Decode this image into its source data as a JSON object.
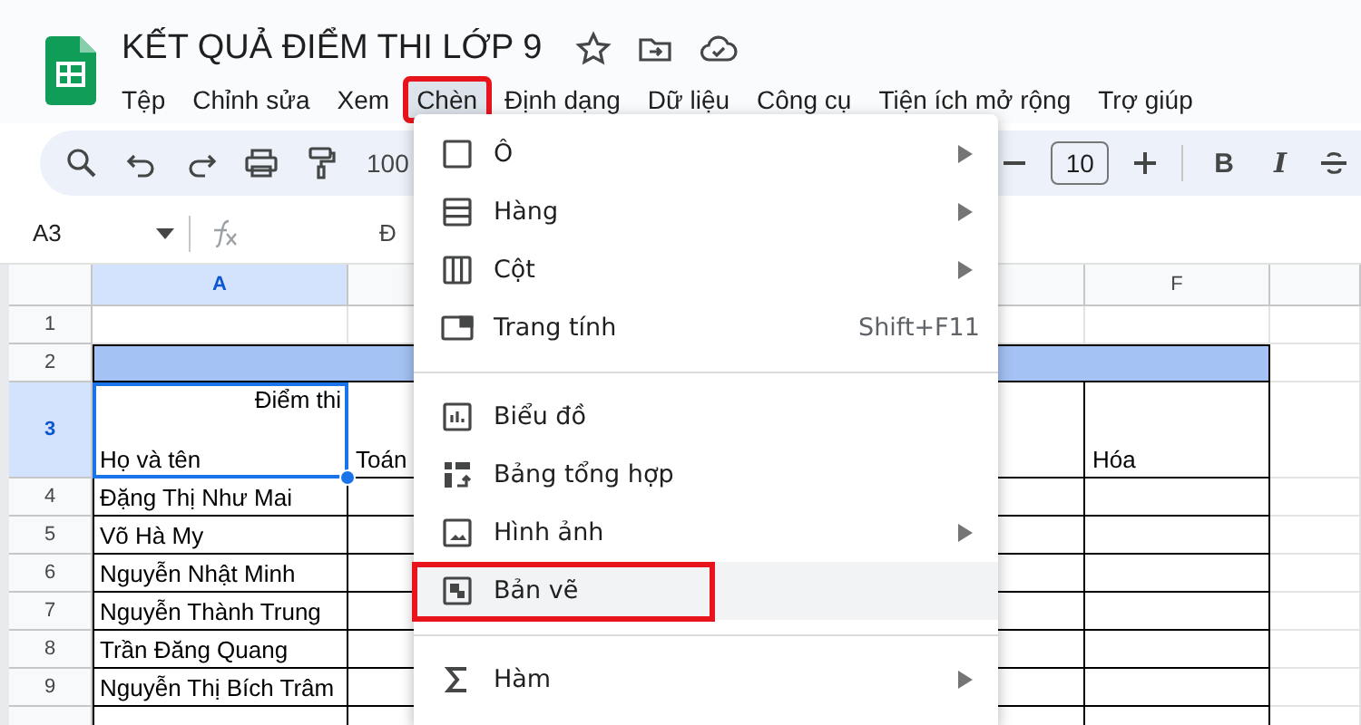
{
  "document": {
    "title": "KẾT QUẢ ĐIỂM THI LỚP 9"
  },
  "menu_bar": [
    {
      "label": "Tệp",
      "highlighted": false
    },
    {
      "label": "Chỉnh sửa",
      "highlighted": false
    },
    {
      "label": "Xem",
      "highlighted": false
    },
    {
      "label": "Chèn",
      "highlighted": true
    },
    {
      "label": "Định dạng",
      "highlighted": false
    },
    {
      "label": "Dữ liệu",
      "highlighted": false
    },
    {
      "label": "Công cụ",
      "highlighted": false
    },
    {
      "label": "Tiện ích mở rộng",
      "highlighted": false
    },
    {
      "label": "Trợ giúp",
      "highlighted": false
    }
  ],
  "toolbar": {
    "zoom": "100",
    "font_size": "10",
    "bold": "B",
    "italic": "I"
  },
  "formula_bar": {
    "cell_ref": "A3",
    "content": "Đ"
  },
  "columns": [
    {
      "label": "A",
      "selected": true
    },
    {
      "label": "F",
      "selected": false
    }
  ],
  "rows": [
    {
      "number": "1",
      "kind": "blank",
      "selected": false
    },
    {
      "number": "2",
      "kind": "banner",
      "selected": false
    },
    {
      "number": "3",
      "kind": "header",
      "selected": true,
      "score_label": "Điểm thi",
      "name_label": "Họ và tên",
      "subject_1": "Toán",
      "subject_2": "Hóa"
    },
    {
      "number": "4",
      "kind": "student",
      "selected": false,
      "name": "Đặng Thị Như Mai"
    },
    {
      "number": "5",
      "kind": "student",
      "selected": false,
      "name": "Võ Hà My"
    },
    {
      "number": "6",
      "kind": "student",
      "selected": false,
      "name": "Nguyễn Nhật Minh"
    },
    {
      "number": "7",
      "kind": "student",
      "selected": false,
      "name": "Nguyễn Thành Trung"
    },
    {
      "number": "8",
      "kind": "student",
      "selected": false,
      "name": "Trần Đăng Quang"
    },
    {
      "number": "9",
      "kind": "student",
      "selected": false,
      "name": "Nguyễn Thị Bích Trâm"
    }
  ],
  "insert_menu": {
    "groups": [
      [
        {
          "label": "Ô",
          "submenu": true,
          "highlighted": false
        },
        {
          "label": "Hàng",
          "submenu": true,
          "highlighted": false
        },
        {
          "label": "Cột",
          "submenu": true,
          "highlighted": false
        },
        {
          "label": "Trang tính",
          "shortcut": "Shift+F11",
          "submenu": false,
          "highlighted": false
        }
      ],
      [
        {
          "label": "Biểu đồ",
          "submenu": false,
          "highlighted": false
        },
        {
          "label": "Bảng tổng hợp",
          "submenu": false,
          "highlighted": false
        },
        {
          "label": "Hình ảnh",
          "submenu": true,
          "highlighted": false
        },
        {
          "label": "Bản vẽ",
          "submenu": false,
          "highlighted": true
        }
      ],
      [
        {
          "label": "Hàm",
          "submenu": true,
          "highlighted": false
        }
      ]
    ]
  }
}
